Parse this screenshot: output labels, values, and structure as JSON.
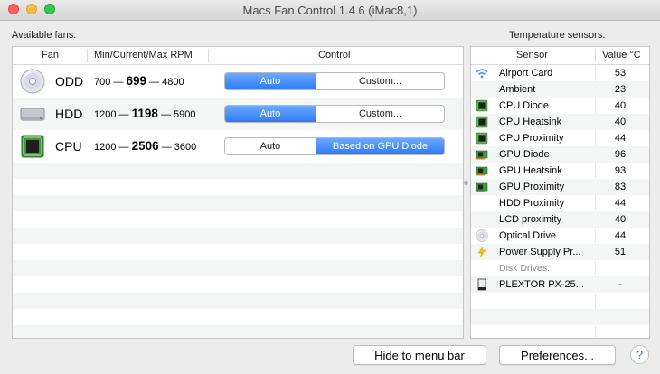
{
  "window": {
    "title": "Macs Fan Control 1.4.6 (iMac8,1)"
  },
  "fans_panel": {
    "label": "Available fans:",
    "columns": {
      "fan": "Fan",
      "rpm": "Min/Current/Max RPM",
      "control": "Control"
    },
    "rows": [
      {
        "name": "ODD",
        "icon": "optical-disc-icon",
        "min": "700",
        "current": "699",
        "max": "4800",
        "dash": "—",
        "controls": [
          "Auto",
          "Custom..."
        ],
        "selected": 0
      },
      {
        "name": "HDD",
        "icon": "hard-drive-icon",
        "min": "1200",
        "current": "1198",
        "max": "5900",
        "dash": "—",
        "controls": [
          "Auto",
          "Custom..."
        ],
        "selected": 0
      },
      {
        "name": "CPU",
        "icon": "cpu-chip-icon",
        "min": "1200",
        "current": "2506",
        "max": "3600",
        "dash": "—",
        "controls": [
          "Auto",
          "Based on GPU Diode"
        ],
        "selected": 1
      }
    ]
  },
  "sensors_panel": {
    "label": "Temperature sensors:",
    "columns": {
      "sensor": "Sensor",
      "value": "Value °C"
    },
    "rows": [
      {
        "name": "Airport Card",
        "value": "53",
        "icon": "wifi-icon"
      },
      {
        "name": "Ambient",
        "value": "23",
        "icon": ""
      },
      {
        "name": "CPU Diode",
        "value": "40",
        "icon": "cpu-chip-icon"
      },
      {
        "name": "CPU Heatsink",
        "value": "40",
        "icon": "cpu-chip-icon"
      },
      {
        "name": "CPU Proximity",
        "value": "44",
        "icon": "cpu-chip-icon"
      },
      {
        "name": "GPU Diode",
        "value": "96",
        "icon": "gpu-card-icon"
      },
      {
        "name": "GPU Heatsink",
        "value": "93",
        "icon": "gpu-card-icon"
      },
      {
        "name": "GPU Proximity",
        "value": "83",
        "icon": "gpu-card-icon"
      },
      {
        "name": "HDD Proximity",
        "value": "44",
        "icon": ""
      },
      {
        "name": "LCD proximity",
        "value": "40",
        "icon": ""
      },
      {
        "name": "Optical Drive",
        "value": "44",
        "icon": "optical-disc-icon"
      },
      {
        "name": "Power Supply Pr...",
        "value": "51",
        "icon": "lightning-icon"
      }
    ],
    "group_label": "Disk Drives:",
    "drives": [
      {
        "name": "PLEXTOR PX-25...",
        "value": "-",
        "icon": "ssd-drive-icon"
      }
    ]
  },
  "footer": {
    "hide_button": "Hide to menu bar",
    "prefs_button": "Preferences...",
    "help_button": "?"
  },
  "colors": {
    "accent": "#2e7bf6",
    "chip_green": "#3d9a3a",
    "row_alt": "#f4f5f5"
  }
}
